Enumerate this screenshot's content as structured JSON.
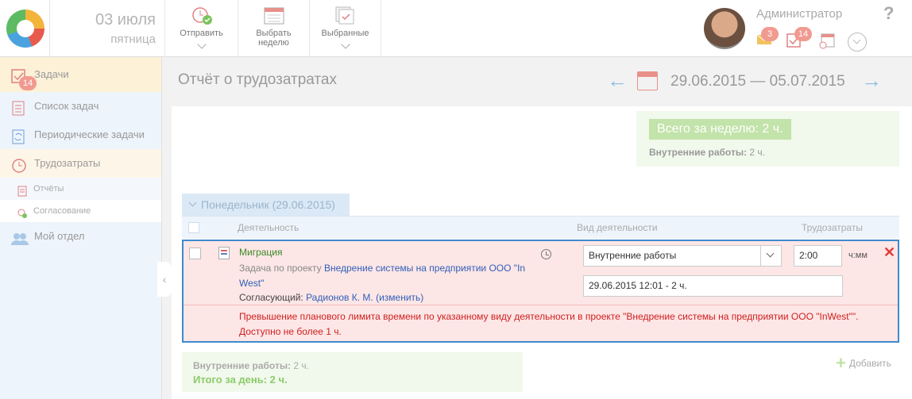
{
  "header": {
    "date": "03 июля",
    "weekday": "пятница",
    "user": "Администратор",
    "badges": {
      "mail": "3",
      "tasks": "14"
    }
  },
  "toolbar": {
    "send": "Отправить",
    "select_week": "Выбрать неделю",
    "selected": "Выбранные"
  },
  "sidebar": {
    "items": [
      {
        "label": "Задачи",
        "badge": "14"
      },
      {
        "label": "Список задач"
      },
      {
        "label": "Периодические задачи"
      },
      {
        "label": "Трудозатраты"
      },
      {
        "label": "Отчёты"
      },
      {
        "label": "Согласование"
      },
      {
        "label": "Мой отдел"
      }
    ]
  },
  "main": {
    "title": "Отчёт о трудозатратах",
    "range": "29.06.2015 — 05.07.2015",
    "week": {
      "total": "Всего за неделю: 2 ч.",
      "internal_label": "Внутренние работы:",
      "internal_value": "2 ч."
    },
    "day_tab": "Понедельник (29.06.2015)",
    "columns": {
      "activity": "Деятельность",
      "kind": "Вид деятельности",
      "effort": "Трудозатраты"
    },
    "row": {
      "name": "Миграция",
      "desc_prefix": "Задача по проекту ",
      "project": "Внедрение системы на предприятии ООО \"In West\"",
      "approver_label": "Согласующий: ",
      "approver": "Радионов К. М.",
      "change": "(изменить)",
      "kind": "Внутренние работы",
      "time": "2:00",
      "unit": "ч:мм",
      "datetime": "29.06.2015 12:01 - 2 ч.",
      "warning": "Превышение планового лимита времени по указанному виду деятельности в проекте \"Внедрение системы на предприятии ООО \"InWest\"\". Доступно не более 1 ч."
    },
    "day_summary": {
      "internal_label": "Внутренние работы:",
      "internal_value": "2 ч.",
      "total": "Итого за день: 2 ч."
    },
    "add": "Добавить"
  },
  "colors": {
    "accent": "#3d8ad0",
    "error": "#d02020",
    "success": "#3a8a26"
  }
}
